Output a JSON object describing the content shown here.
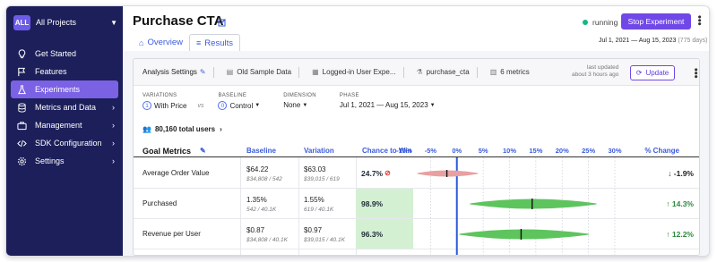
{
  "sidebar": {
    "project_badge": "ALL",
    "project_name": "All Projects",
    "items": [
      {
        "label": "Get Started",
        "icon": "lightbulb-icon",
        "active": false,
        "has_chevron": false
      },
      {
        "label": "Features",
        "icon": "flag-icon",
        "active": false,
        "has_chevron": false
      },
      {
        "label": "Experiments",
        "icon": "flask-icon",
        "active": true,
        "has_chevron": false
      },
      {
        "label": "Metrics and Data",
        "icon": "database-icon",
        "active": false,
        "has_chevron": true
      },
      {
        "label": "Management",
        "icon": "briefcase-icon",
        "active": false,
        "has_chevron": true
      },
      {
        "label": "SDK Configuration",
        "icon": "code-icon",
        "active": false,
        "has_chevron": true
      },
      {
        "label": "Settings",
        "icon": "gear-icon",
        "active": false,
        "has_chevron": true
      }
    ]
  },
  "header": {
    "title": "Purchase CTA",
    "tabs": [
      {
        "label": "Overview",
        "active": false
      },
      {
        "label": "Results",
        "active": true
      }
    ],
    "status": "running",
    "stop_button": "Stop Experiment",
    "date_range": "Jul 1, 2021 — Aug 15, 2023",
    "date_days": "(775 days)"
  },
  "settings_bar": {
    "analysis_settings": "Analysis Settings",
    "datasource": "Old Sample Data",
    "assignment": "Logged-in User Expe...",
    "metric_id": "purchase_cta",
    "metrics_count": "6 metrics",
    "last_updated_label": "last updated",
    "last_updated_value": "about 3 hours ago",
    "update_button": "Update"
  },
  "filters": {
    "variations": {
      "label": "VARIATIONS",
      "num": "1",
      "value": "With Price"
    },
    "vs": "vs",
    "baseline": {
      "label": "BASELINE",
      "num": "0",
      "value": "Control"
    },
    "dimension": {
      "label": "DIMENSION",
      "value": "None"
    },
    "phase": {
      "label": "PHASE",
      "value": "Jul 1, 2021 — Aug 15, 2023"
    }
  },
  "total_users": "80,160 total users",
  "table": {
    "headers": {
      "metric": "Goal Metrics",
      "baseline": "Baseline",
      "variation": "Variation",
      "ctw": "Chance to Win",
      "change": "% Change"
    },
    "axis_ticks": [
      "-10%",
      "-5%",
      "0%",
      "5%",
      "10%",
      "15%",
      "20%",
      "25%",
      "30%"
    ],
    "rows": [
      {
        "metric": "Average Order Value",
        "baseline": "$64.22",
        "baseline_sub": "$34,808 / 542",
        "variation": "$63.03",
        "variation_sub": "$39,015 / 619",
        "ctw": "24.7%",
        "ctw_win": false,
        "change": "-1.9%",
        "direction": "down"
      },
      {
        "metric": "Purchased",
        "baseline": "1.35%",
        "baseline_sub": "542 / 40.1K",
        "variation": "1.55%",
        "variation_sub": "619 / 40.1K",
        "ctw": "98.9%",
        "ctw_win": true,
        "change": "14.3%",
        "direction": "up"
      },
      {
        "metric": "Revenue per User",
        "baseline": "$0.87",
        "baseline_sub": "$34,808 / 40.1K",
        "variation": "$0.97",
        "variation_sub": "$39,015 / 40.1K",
        "ctw": "96.3%",
        "ctw_win": true,
        "change": "12.2%",
        "direction": "up"
      }
    ]
  },
  "chart_data": {
    "type": "violin",
    "x_unit": "% change",
    "xlim": [
      -10,
      30
    ],
    "categories": [
      "Average Order Value",
      "Purchased",
      "Revenue per User"
    ],
    "intervals": [
      {
        "low": -7.5,
        "mid": -1.9,
        "high": 4,
        "color": "#e8a0a0"
      },
      {
        "low": 2.5,
        "mid": 14.3,
        "high": 26.5,
        "color": "#5ec45e"
      },
      {
        "low": 0.5,
        "mid": 12.2,
        "high": 25,
        "color": "#5ec45e"
      }
    ]
  },
  "colors": {
    "sidebar": "#1c1f5a",
    "accent": "#7048e8",
    "link": "#3b5bdb",
    "win": "#d3f0d3",
    "positive": "#2b8a3e",
    "zero_line": "#2b5bd6"
  }
}
